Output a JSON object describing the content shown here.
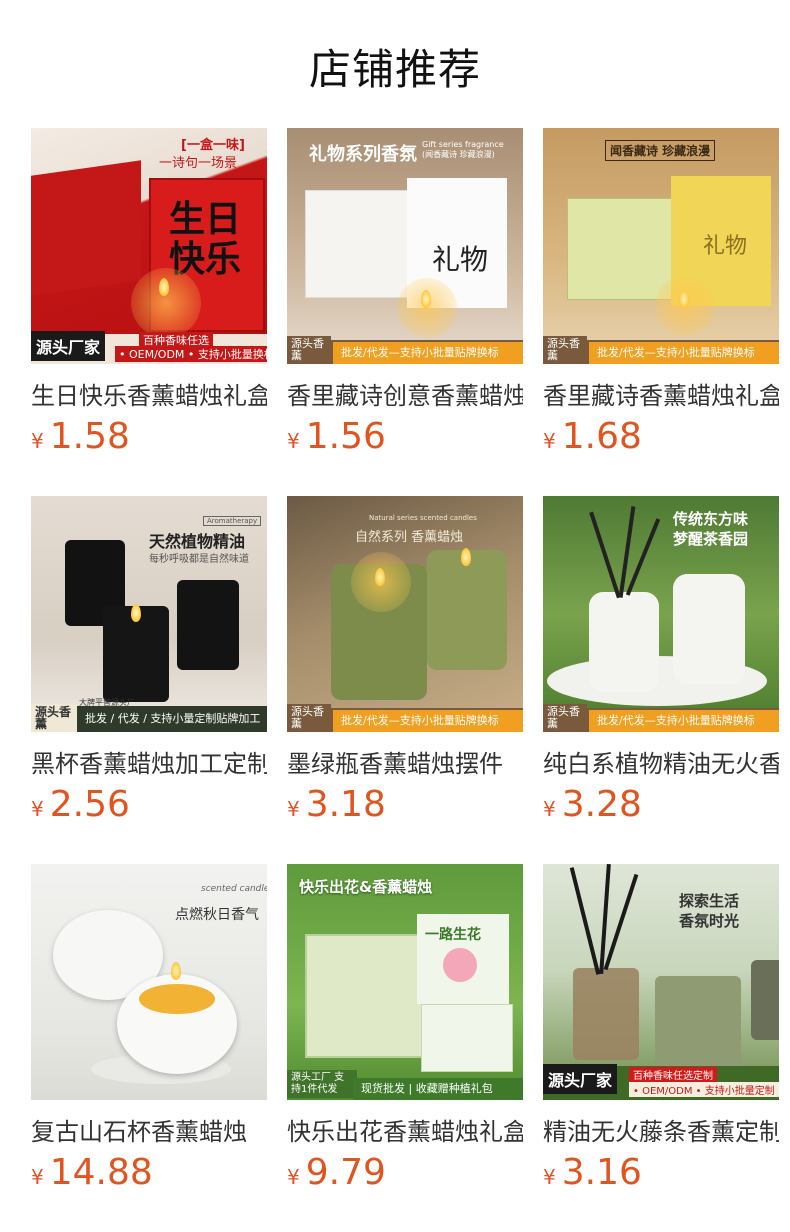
{
  "page": {
    "title": "店铺推荐"
  },
  "products": [
    {
      "name": "生日快乐香薰蜡烛礼盒",
      "currency": "¥",
      "price": "1.58",
      "image": {
        "headline": "[一盒一味]",
        "sub": "一诗句一场景",
        "big": "生日快乐",
        "badge": "源头厂家",
        "strip1": "百种香味任选",
        "strip2": "• OEM/ODM • 支持小批量换标"
      }
    },
    {
      "name": "香里藏诗创意香薰蜡烛礼盒",
      "currency": "¥",
      "price": "1.56",
      "image": {
        "headline": "礼物系列香氛",
        "sub": "Gift series fragrance (闻香藏诗 珍藏浪漫)",
        "big": "礼物",
        "badge": "源头香薰",
        "strip": "批发/代发—支持小批量贴牌换标"
      }
    },
    {
      "name": "香里藏诗香薰蜡烛礼盒",
      "currency": "¥",
      "price": "1.68",
      "image": {
        "headline": "闻香藏诗 珍藏浪漫",
        "big": "礼物",
        "badge": "源头香薰",
        "strip": "批发/代发—支持小批量贴牌换标"
      }
    },
    {
      "name": "黑杯香薰蜡烛加工定制",
      "currency": "¥",
      "price": "2.56",
      "image": {
        "headline": "天然植物精油",
        "sub": "每秒呼吸都是自然味道",
        "tag": "Aromatherapy",
        "badge": "源头香薰",
        "badge_top": "大牌平替源头厂",
        "strip": "批发 / 代发 / 支持小量定制贴牌加工"
      }
    },
    {
      "name": "墨绿瓶香薰蜡烛摆件",
      "currency": "¥",
      "price": "3.18",
      "image": {
        "headline": "自然系列 香薰蜡烛",
        "tag": "Natural series scented candles",
        "badge": "源头香薰",
        "strip": "批发/代发—支持小批量贴牌换标"
      }
    },
    {
      "name": "纯白系植物精油无火香薰",
      "currency": "¥",
      "price": "3.28",
      "image": {
        "headline": "传统东方味",
        "sub": "梦醒茶香园",
        "badge": "源头香薰",
        "strip": "批发/代发—支持小批量贴牌换标"
      }
    },
    {
      "name": "复古山石杯香薰蜡烛",
      "currency": "¥",
      "price": "14.88",
      "image": {
        "headline": "点燃秋日香气",
        "tag": "scented candles"
      }
    },
    {
      "name": "快乐出花香薰蜡烛礼盒",
      "currency": "¥",
      "price": "9.79",
      "image": {
        "headline": "快乐出花&香薰蜡烛",
        "box": "一路生花",
        "badge": "源头工厂 支持1件代发",
        "strip": "现货批发 | 收藏赠种植礼包"
      }
    },
    {
      "name": "精油无火藤条香薰定制",
      "currency": "¥",
      "price": "3.16",
      "image": {
        "headline": "探索生活",
        "sub": "香氛时光",
        "badge": "源头厂家",
        "strip1": "百种香味任选定制",
        "strip2": "• OEM/ODM • 支持小批量定制"
      }
    }
  ],
  "colors": {
    "price": "#e0551f",
    "strip_orange": "#f0a020",
    "strip_red": "#d21a1a"
  }
}
